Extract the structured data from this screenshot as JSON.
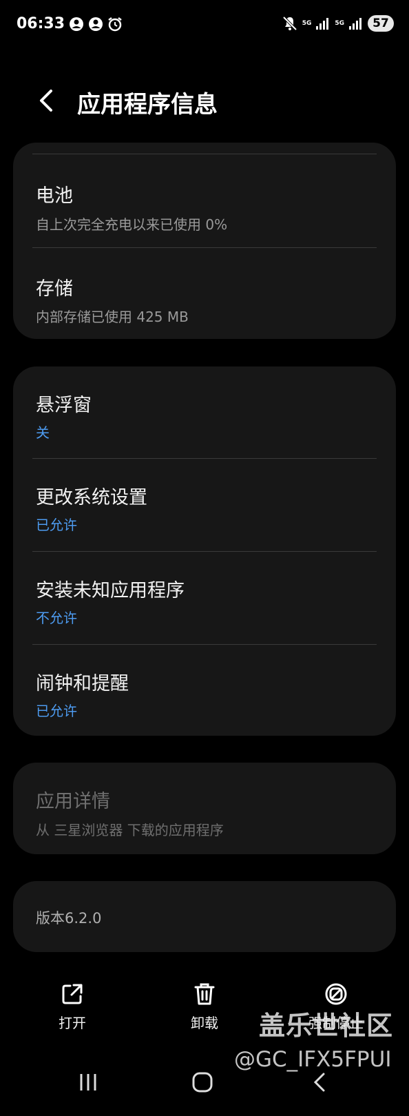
{
  "status_bar": {
    "time": "06:33",
    "battery": "57",
    "net1": "5G",
    "net2": "5G"
  },
  "header": {
    "title": "应用程序信息"
  },
  "card1": {
    "battery_title": "电池",
    "battery_sub": "自上次完全充电以来已使用 0%",
    "storage_title": "存储",
    "storage_sub": "内部存储已使用 425 MB"
  },
  "card2": {
    "items": [
      {
        "title": "悬浮窗",
        "value": "关"
      },
      {
        "title": "更改系统设置",
        "value": "已允许"
      },
      {
        "title": "安装未知应用程序",
        "value": "不允许"
      },
      {
        "title": "闹钟和提醒",
        "value": "已允许"
      }
    ]
  },
  "card3": {
    "title": "应用详情",
    "sub": "从 三星浏览器 下载的应用程序"
  },
  "card4": {
    "version": "版本6.2.0"
  },
  "actions": {
    "open": "打开",
    "uninstall": "卸载",
    "force_stop": "强制停止"
  },
  "watermark": {
    "line1": "盖乐世社区",
    "line2": "@GC_IFX5FPUI"
  },
  "colors": {
    "accent": "#4d9bf0",
    "card": "#171717",
    "background": "#000000"
  }
}
